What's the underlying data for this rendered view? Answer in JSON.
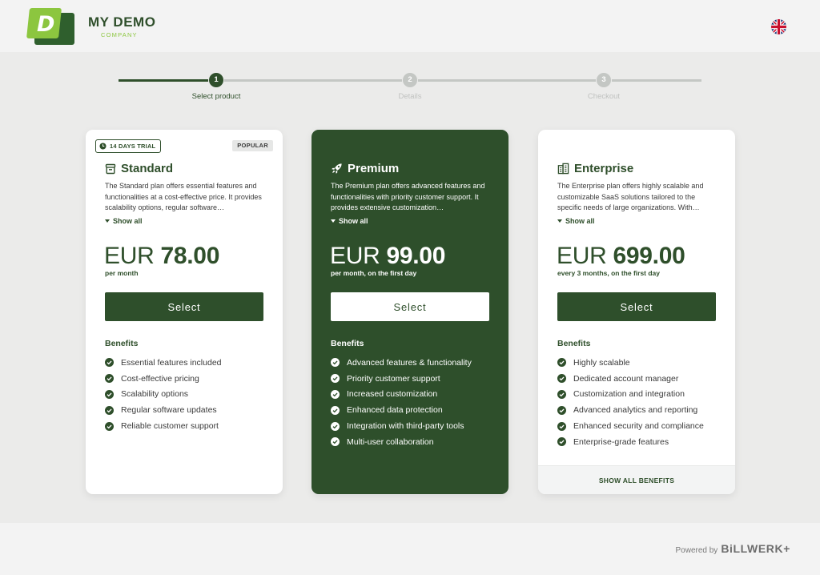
{
  "brand": {
    "logo_letter": "D",
    "name": "MY DEMO",
    "subtitle": "COMPANY",
    "logo_colors": {
      "front": "#8cc63f",
      "back": "#2f5f2d"
    }
  },
  "language": {
    "flag_icon": "uk-flag-icon"
  },
  "stepper": {
    "steps": [
      {
        "number": "1",
        "label": "Select product",
        "active": true
      },
      {
        "number": "2",
        "label": "Details",
        "active": false
      },
      {
        "number": "3",
        "label": "Checkout",
        "active": false
      }
    ]
  },
  "plans": [
    {
      "icon": "storage-icon",
      "trial_badge": "14 DAYS TRIAL",
      "popular_badge": "POPULAR",
      "name": "Standard",
      "description": "The Standard plan offers essential features and functionalities at a cost-effective price. It provides scalability options, regular software…",
      "show_all": "Show all",
      "currency": "EUR",
      "amount": "78.00",
      "period": "per month",
      "select_label": "Select",
      "benefits_title": "Benefits",
      "benefits": [
        "Essential features included",
        "Cost-effective pricing",
        "Scalability options",
        "Regular software updates",
        "Reliable customer support"
      ]
    },
    {
      "icon": "rocket-icon",
      "name": "Premium",
      "description": "The Premium plan offers advanced features and functionalities with priority customer support. It provides extensive customization…",
      "show_all": "Show all",
      "currency": "EUR",
      "amount": "99.00",
      "period": "per month, on the first day",
      "select_label": "Select",
      "benefits_title": "Benefits",
      "benefits": [
        "Advanced features & functionality",
        "Priority customer support",
        "Increased customization",
        "Enhanced data protection",
        "Integration with third-party tools",
        "Multi-user collaboration"
      ]
    },
    {
      "icon": "building-icon",
      "name": "Enterprise",
      "description": "The Enterprise plan offers highly scalable and customizable SaaS solutions tailored to the specific needs of large organizations. With…",
      "show_all": "Show all",
      "currency": "EUR",
      "amount": "699.00",
      "period": "every 3 months, on the first day",
      "select_label": "Select",
      "benefits_title": "Benefits",
      "benefits": [
        "Highly scalable",
        "Dedicated account manager",
        "Customization and integration",
        "Advanced analytics and reporting",
        "Enhanced security and compliance",
        "Enterprise-grade features"
      ],
      "show_all_benefits": "SHOW ALL BENEFITS"
    }
  ],
  "footer": {
    "powered_by": "Powered by",
    "provider": "BiLLWERK+"
  },
  "colors": {
    "primary": "#2f4f2b",
    "accent": "#8cc63f",
    "background": "#ebebea"
  }
}
